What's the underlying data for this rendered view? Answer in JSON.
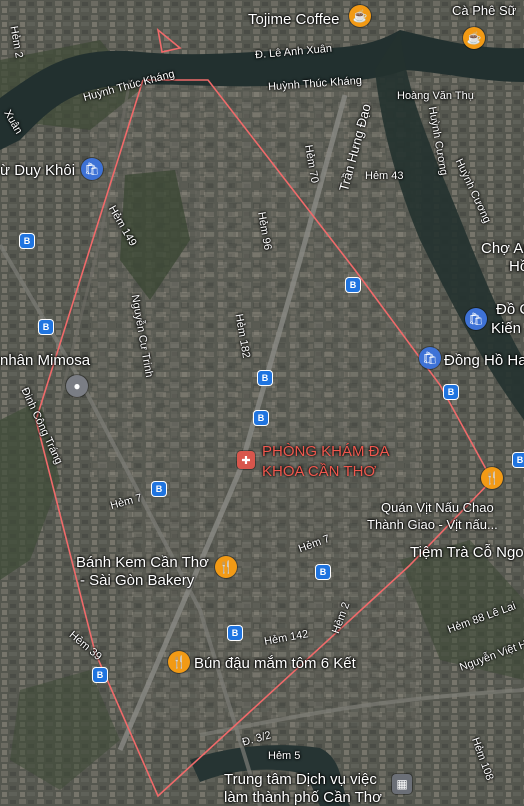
{
  "map": {
    "colors": {
      "boundary": "#f06a6a",
      "river": "#22302f",
      "poi_food": "#f29a15",
      "poi_shop": "#3e72d6",
      "clinic": "#f0584e",
      "bus": "#1f74e0"
    },
    "labels": {
      "tojime": "Tojime Coffee",
      "caphesu": "Cà Phê Sữ",
      "le_anh_xuan": "Đ. Lê Anh Xuân",
      "huynh_thuc_khang_1": "Huỳnh Thúc Kháng",
      "huynh_thuc_khang_2": "Huỳnh Thúc Kháng",
      "hoang_van_thu": "Hoàng Văn Thụ",
      "huynh_cuong_1": "Huỳnh Cương",
      "huynh_cuong_2": "Huỳnh Cương",
      "tran_hung_dao": "Trần Hưng Đạo",
      "hem70": "Hẻm 70",
      "hem43": "Hẻm 43",
      "tu_duy_khoi": "ừ Duy Khôi",
      "hem149": "Hẻm 149",
      "hem96": "Hẻm 96",
      "cho_an": "Chợ An",
      "ho": "Hồ",
      "doc": "Đồ C",
      "kien": "Kiến",
      "nguyen_cu_trinh": "Nguyễn Cư Trinh",
      "hem182": "Hẻm 182",
      "mimosa": "nhân Mimosa",
      "dong_ho": "Đồng Hồ Ha",
      "dinh_cong_trang": "Đinh Công Tráng",
      "clinic_1": "PHÒNG KHÁM ĐA",
      "clinic_2": "KHOA CẦN THƠ",
      "quan_vit_1": "Quán Vịt Nấu Chao",
      "quan_vit_2": "Thành Giao - Vịt nấu...",
      "hem7a": "Hẻm 7",
      "hem7b": "Hẻm 7",
      "tiem_tra": "Tiệm Trà Cỗ Ngo",
      "bakery_1": "Bánh Kem Cần Thơ",
      "bakery_2": "- Sài Gòn Bakery",
      "hem2": "Hẻm 2",
      "hem88": "Hẻm 88 Lê Lai",
      "hem142": "Hẻm 142",
      "hem39": "Hẻm 39",
      "bun_dau": "Bún đậu mắm tôm 6 Kết",
      "nguyen_viet": "Nguyễn Việt H",
      "d32": "Đ. 3/2",
      "hem5": "Hẻm 5",
      "hem108": "Hẻm 108",
      "trung_tam_1": "Trung tâm Dịch vụ việc",
      "trung_tam_2": "làm thành phố Cần Thơ",
      "xuan_top": "Xuân",
      "hem2_left": "Hẻm 2"
    },
    "icons": {
      "food": "fork-knife-icon",
      "coffee": "coffee-cup-icon",
      "shop": "shopping-bag-icon",
      "place": "location-pin-icon",
      "clinic": "hospital-icon",
      "bus": "bus-stop-icon",
      "gov": "building-icon"
    }
  }
}
